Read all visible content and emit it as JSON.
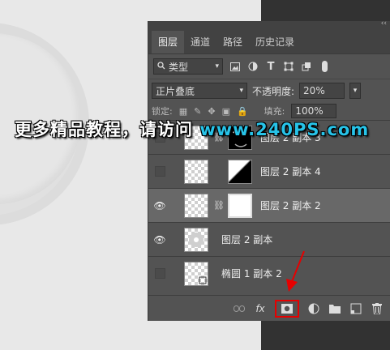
{
  "panel": {
    "collapse_glyph": "‹‹",
    "tabs": [
      {
        "label": "图层",
        "active": true
      },
      {
        "label": "通道",
        "active": false
      },
      {
        "label": "路径",
        "active": false
      },
      {
        "label": "历史记录",
        "active": false
      }
    ],
    "filter": {
      "kind_label": "类型",
      "search_icon": "search-icon",
      "icons": [
        "image-filter-icon",
        "adjustment-filter-icon",
        "text-filter-icon",
        "shape-filter-icon",
        "smart-object-filter-icon"
      ],
      "text_glyph": "T"
    },
    "blend": {
      "mode": "正片叠底",
      "opacity_label": "不透明度:",
      "opacity_value": "20%"
    },
    "lock": {
      "label": "锁定:",
      "fill_label": "填充:",
      "fill_value": "100%"
    },
    "layers": [
      {
        "name": "图层 2 副本 3",
        "visible": false,
        "selected": false
      },
      {
        "name": "图层 2 副本 4",
        "visible": false,
        "selected": false
      },
      {
        "name": "图层 2 副本 2",
        "visible": true,
        "selected": true
      },
      {
        "name": "图层 2 副本",
        "visible": true,
        "selected": false
      },
      {
        "name": "椭圆 1 副本 2",
        "visible": false,
        "selected": false
      }
    ],
    "bottom": {
      "fx_label": "fx"
    }
  },
  "watermark": {
    "text": "更多精品教程，请访问",
    "url": "www.240PS.com"
  },
  "colors": {
    "panel_bg": "#535353",
    "selected_row": "#686868",
    "highlight_red": "#e60000",
    "watermark_blue": "#27c3e8"
  }
}
